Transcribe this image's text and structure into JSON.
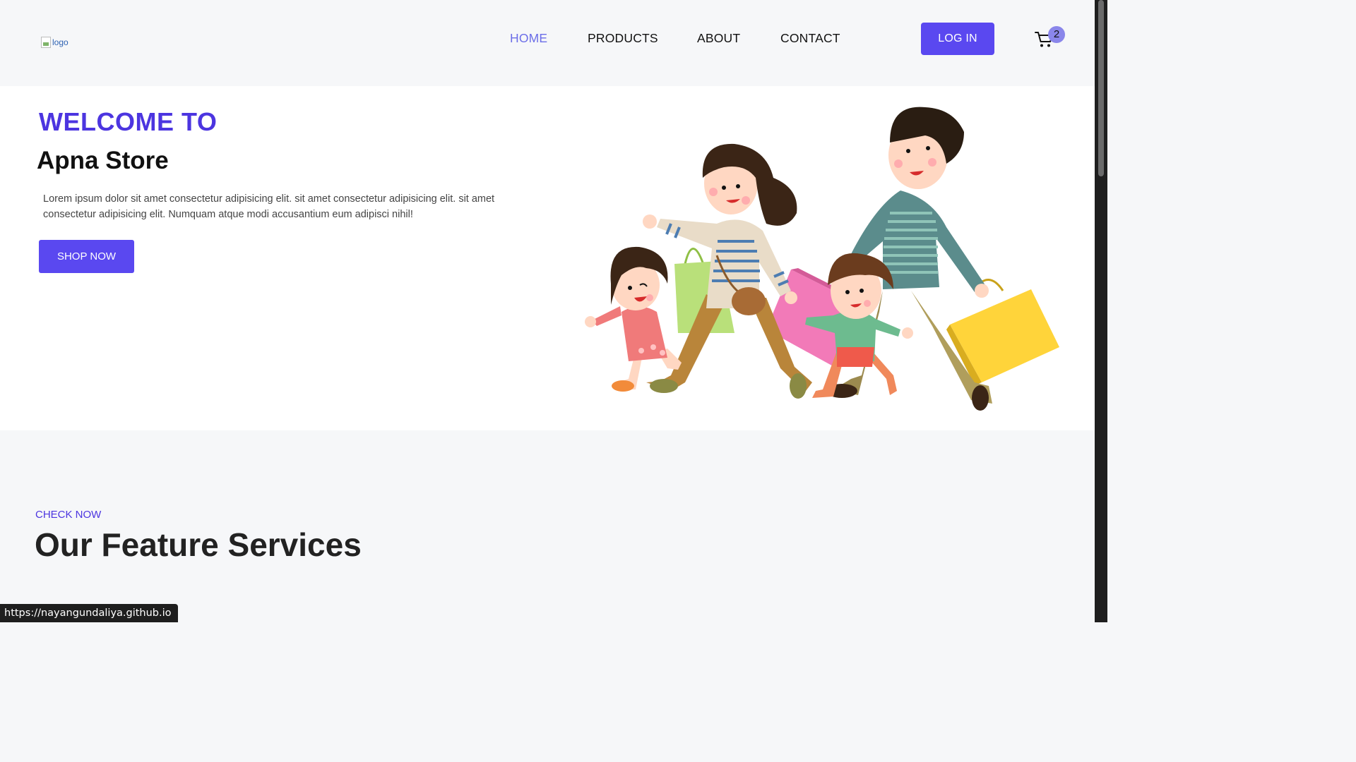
{
  "header": {
    "logo_alt": "logo",
    "nav": [
      {
        "label": "HOME",
        "active": true
      },
      {
        "label": "PRODUCTS",
        "active": false
      },
      {
        "label": "ABOUT",
        "active": false
      },
      {
        "label": "CONTACT",
        "active": false
      }
    ],
    "login_label": "LOG IN",
    "cart_count": "2",
    "cart_icon": "cart-icon"
  },
  "hero": {
    "welcome": "WELCOME TO",
    "store_name": "Apna Store",
    "description": "Lorem ipsum dolor sit amet consectetur adipisicing elit. sit amet consectetur adipisicing elit. sit amet consectetur adipisicing elit. Numquam atque modi accusantium eum adipisci nihil!",
    "cta_label": "SHOP NOW",
    "illustration": "family-shopping-illustration"
  },
  "features": {
    "kicker": "CHECK NOW",
    "title": "Our Feature Services"
  },
  "status_bar": {
    "url": "https://nayangundaliya.github.io"
  },
  "colors": {
    "accent": "#5a48f0",
    "heading_accent": "#4c35e0",
    "nav_active": "#6c6ee8",
    "page_bg": "#f6f7f9"
  }
}
